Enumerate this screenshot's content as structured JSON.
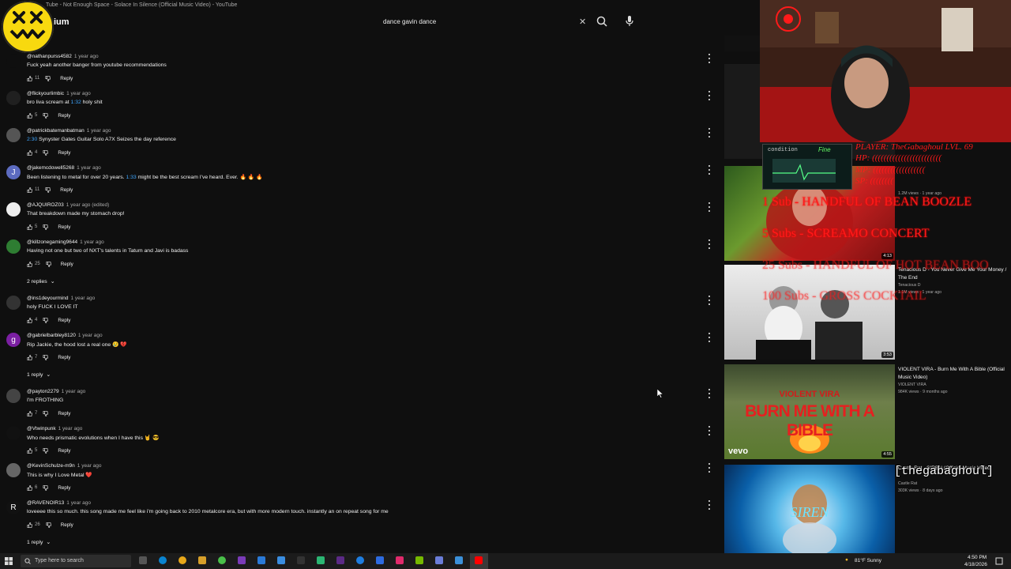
{
  "window": {
    "title": "Tube - Not Enough Space - Solace In Silence (Official Music Video) - YouTube"
  },
  "header": {
    "logo_suffix": "ium",
    "search_value": "dance gavin dance"
  },
  "comments": [
    {
      "handle": "@nathanpurss4582",
      "age": "1 year ago",
      "text": "Fuck yeah another banger from youtube recommendations",
      "likes": "11",
      "reply": "Reply",
      "avatar_color": "#0f0f0f",
      "avatar_letter": ""
    },
    {
      "handle": "@flickyourlimbic",
      "age": "1 year ago",
      "pre": "bro liva scream at ",
      "ts": "1:32",
      "post": " holy shit",
      "likes": "5",
      "reply": "Reply",
      "avatar_color": "#202020",
      "avatar_letter": ""
    },
    {
      "handle": "@patrickbatemanbatman",
      "age": "1 year ago",
      "pre": "",
      "ts": "2:30",
      "post": " Synyster Gates Guitar Solo A7X Seizes the day reference",
      "likes": "4",
      "reply": "Reply",
      "avatar_color": "#555",
      "avatar_letter": ""
    },
    {
      "handle": "@jakemcdowell5268",
      "age": "1 year ago",
      "pre": "Been listening to metal for over 20 years. ",
      "ts": "1:33",
      "post": " might be the best scream I've heard. Ever. 🔥 🔥 🔥",
      "likes": "11",
      "reply": "Reply",
      "avatar_color": "#5c6bc0",
      "avatar_letter": "J"
    },
    {
      "handle": "@AJQUIROZ03",
      "age": "1 year ago (edited)",
      "text": "That breakdown made my stomach drop!",
      "likes": "5",
      "reply": "Reply",
      "avatar_color": "#eeeeee",
      "avatar_letter": ""
    },
    {
      "handle": "@killzonegaming9644",
      "age": "1 year ago",
      "text": "Having not one but two of NXT's talents in Tatum and Javi is badass",
      "likes": "25",
      "reply": "Reply",
      "avatar_color": "#2e7d32",
      "avatar_letter": ""
    },
    {
      "handle": "@ins1deyourmind",
      "age": "1 year ago",
      "text": "holy FUCK I LOVE IT",
      "likes": "4",
      "reply": "Reply",
      "avatar_color": "#333",
      "avatar_letter": ""
    },
    {
      "handle": "@gabrielbarbley8120",
      "age": "1 year ago",
      "text": "Rip Jackie, the hood lost a real one 😢 💔",
      "likes": "7",
      "reply": "Reply",
      "avatar_color": "#7b1fa2",
      "avatar_letter": "g"
    },
    {
      "handle": "@payton2279",
      "age": "1 year ago",
      "text": "I'm FROTHING",
      "likes": "7",
      "reply": "Reply",
      "avatar_color": "#444",
      "avatar_letter": ""
    },
    {
      "handle": "@Vtwinpunk",
      "age": "1 year ago",
      "text": "Who needs prismatic evolutions when I have this 🤘 😎",
      "likes": "5",
      "reply": "Reply",
      "avatar_color": "#111",
      "avatar_letter": ""
    },
    {
      "handle": "@KevinSchulze-m9n",
      "age": "1 year ago",
      "text": "This is why I Love Metal ❤️",
      "likes": "6",
      "reply": "Reply",
      "avatar_color": "#666",
      "avatar_letter": ""
    },
    {
      "handle": "@RAVENOIR13",
      "age": "1 year ago",
      "text": "loveeee this so much. this song made me feel like i'm going back to 2010 metalcore era, but with more modern touch. instantly an on repeat song for me",
      "likes": "26",
      "reply": "Reply",
      "avatar_color": "#111",
      "avatar_letter": "R"
    }
  ],
  "replies": {
    "two": "2 replies",
    "one_a": "1 reply",
    "one_b": "1 reply"
  },
  "sidebar": {
    "v1": {
      "views": "1.2M views · 1 year ago",
      "duration": "4:13"
    },
    "v2": {
      "title": "Tenacious D - You Never Give Me Your Money / The End",
      "channel": "Tenacious D",
      "meta": "1.1M views · 1 year ago",
      "duration": "3:53"
    },
    "v3": {
      "title": "VIOLENT VIRA - Burn Me With A Bible (Official Music Video)",
      "channel": "VIOLENT VIRA",
      "meta": "984K views · 9 months ago",
      "duration": "4:55",
      "thumb_text_1": "VIOLENT VIRA",
      "thumb_text_2": "BURN ME WITH A BIBLE",
      "thumb_brand": "vevo"
    },
    "v4": {
      "title": "Castle Rat - SIREN (Official Music Video)",
      "channel": "Castle Rat",
      "meta": "303K views · 8 days ago",
      "thumb_text": "SIREN"
    }
  },
  "overlay": {
    "player": "PLAYER: TheGabaghoul LVL. 69",
    "hp": "HP:    ((((((((((((((((((((((((",
    "mp": "MP:    ((((((((((((((((((",
    "sp": "SP:    ((((((((",
    "condition_label": "condition",
    "condition_value": "Fine",
    "sub1": "1 Sub - HANDFUL OF BEAN BOOZLE",
    "sub5": "5 Subs - SCREAMO CONCERT",
    "sub25": "25 Subs - HANDFUL OF HOT BEAN BOO",
    "sub100": "100 Subs - GROSS COCKTAIL",
    "username": "[thegabaghoul]"
  },
  "taskbar": {
    "search_placeholder": "Type here to search",
    "weather": "81°F Sunny",
    "time": "4:50 PM",
    "date": "4/18/2026"
  },
  "colors": {
    "background": "#0f0f0f",
    "link": "#3ea6ff",
    "overlay_red": "#ff1a1a",
    "emoji_yellow": "#f8d90f"
  }
}
